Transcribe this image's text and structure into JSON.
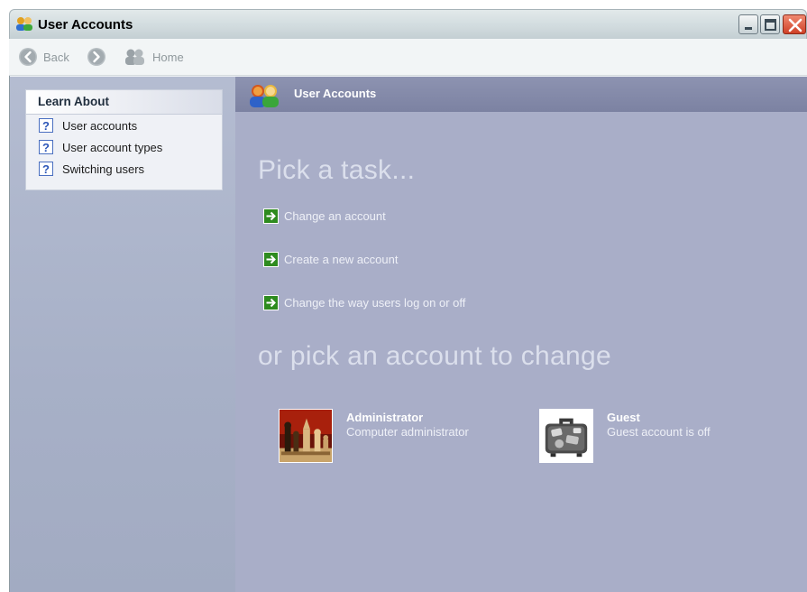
{
  "window": {
    "title": "User Accounts",
    "controls": [
      "minimize-icon",
      "maximize-icon",
      "close-icon"
    ]
  },
  "toolbar": {
    "back_label": "Back",
    "forward_icon": "forward-arrow-icon",
    "home_label": "Home"
  },
  "sidebar": {
    "learn_about": {
      "heading": "Learn About",
      "items": [
        {
          "label": "User accounts",
          "icon": "help-icon"
        },
        {
          "label": "User account types",
          "icon": "help-icon"
        },
        {
          "label": "Switching users",
          "icon": "help-icon"
        }
      ]
    }
  },
  "main": {
    "header_title": "User Accounts",
    "pick_task_heading": "Pick a task...",
    "tasks": [
      {
        "label": "Change an account",
        "icon": "green-arrow-icon"
      },
      {
        "label": "Create a new account",
        "icon": "green-arrow-icon"
      },
      {
        "label": "Change the way users log on or off",
        "icon": "green-arrow-icon"
      }
    ],
    "pick_account_heading": "or pick an account to change",
    "accounts": [
      {
        "name": "Administrator",
        "type": "Computer administrator",
        "picture": "chess-pieces-picture"
      },
      {
        "name": "Guest",
        "type": "Guest account is off",
        "picture": "suitcase-picture"
      }
    ]
  },
  "colors": {
    "main_background": "#a9aec8",
    "header_background": "#8086a6",
    "sidebar_background": "#a9b1c8",
    "task_arrow": "#2e8b1f",
    "heading_text": "#dbdfec"
  }
}
